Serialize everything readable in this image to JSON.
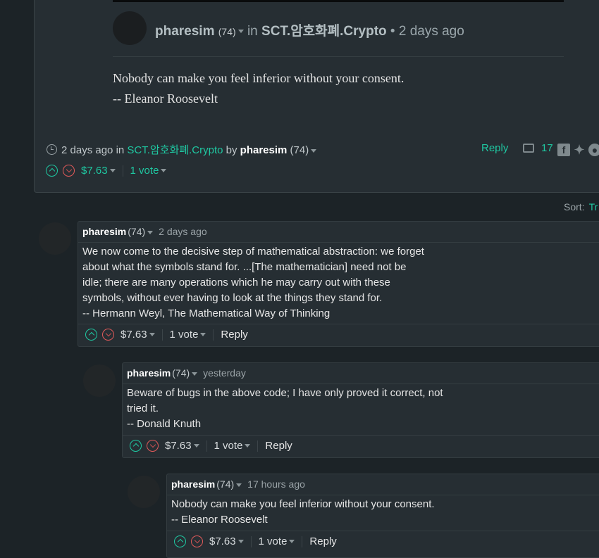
{
  "post": {
    "author": "pharesim",
    "reputation": "(74)",
    "in_label": "in",
    "community": "SCT.암호화폐.Crypto",
    "time_sep": "•",
    "time": "2 days ago",
    "body_line1": "Nobody can make you feel inferior without your consent.",
    "body_line2": "-- Eleanor Roosevelt",
    "footer_time": "2 days ago",
    "footer_in": "in",
    "footer_community": "SCT.암호화폐.Crypto",
    "footer_by": "by",
    "footer_author": "pharesim",
    "footer_rep": "(74)",
    "reply_label": "Reply",
    "comment_count": "17",
    "payout": "$7.63",
    "votes": "1 vote"
  },
  "sort": {
    "label": "Sort:",
    "value": "Tr"
  },
  "comments": [
    {
      "author": "pharesim",
      "reputation": "(74)",
      "time": "2 days ago",
      "lines": [
        "We now come to the decisive step of mathematical abstraction: we forget",
        "about what the symbols stand for. ...[The mathematician] need not be",
        "idle; there are many operations which he may carry out with these",
        "symbols, without ever having to look at the things they stand for.",
        "-- Hermann Weyl, The Mathematical Way of Thinking"
      ],
      "payout": "$7.63",
      "votes": "1 vote",
      "reply_label": "Reply"
    },
    {
      "author": "pharesim",
      "reputation": "(74)",
      "time": "yesterday",
      "lines": [
        "Beware of bugs in the above code; I have only proved it correct, not",
        "tried it.",
        "-- Donald Knuth"
      ],
      "payout": "$7.63",
      "votes": "1 vote",
      "reply_label": "Reply"
    },
    {
      "author": "pharesim",
      "reputation": "(74)",
      "time": "17 hours ago",
      "lines": [
        "Nobody can make you feel inferior without your consent.",
        "-- Eleanor Roosevelt"
      ],
      "payout": "$7.63",
      "votes": "1 vote",
      "reply_label": "Reply"
    }
  ],
  "colors": {
    "accent": "#1fc8a2",
    "downvote": "#e15a5a",
    "background": "#1c2327",
    "card": "#262e33"
  }
}
